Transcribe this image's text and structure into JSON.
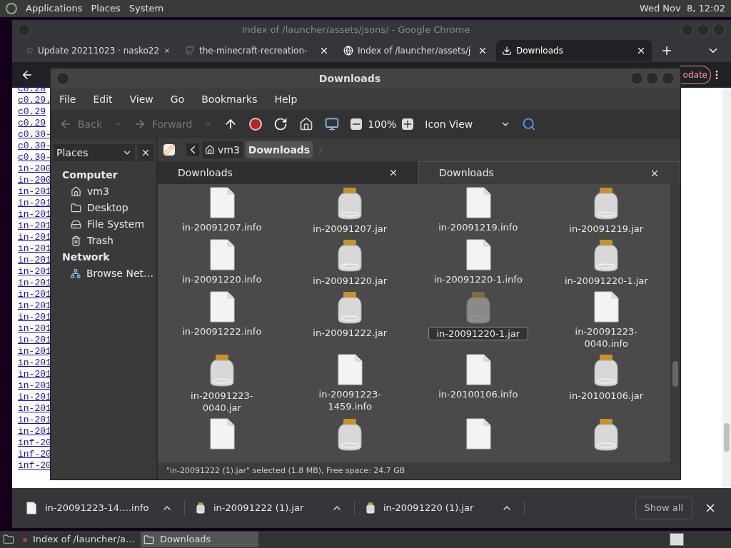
{
  "top_panel": {
    "menus": [
      "Applications",
      "Places",
      "System"
    ],
    "clock": "Wed Nov  8, 12:02"
  },
  "chrome": {
    "title": "Index of /launcher/assets/jsons/ - Google Chrome",
    "tabs": [
      {
        "label": "Update 20211023 · nasko22",
        "kind": "github",
        "selected": false
      },
      {
        "label": "the-minecraft-recreation-",
        "kind": "github",
        "selected": false
      },
      {
        "label": "Index of /launcher/assets/j",
        "kind": "globe",
        "selected": false
      },
      {
        "label": "Downloads",
        "kind": "download",
        "selected": true
      }
    ],
    "update_button": "odate",
    "page_links": [
      "c0.28",
      "c0.29.",
      "c0.29",
      "c0.29",
      "c0.30-",
      "c0.30-",
      "c0.30-",
      "in-200",
      "in-200",
      "in-201",
      "in-201",
      "in-201",
      "in-201",
      "in-201",
      "in-201",
      "in-201",
      "in-201",
      "in-201",
      "in-201",
      "in-201",
      "in-201",
      "in-201",
      "in-201",
      "in-201",
      "in-201",
      "in-201",
      "in-201",
      "in-201",
      "in-201",
      "in-201",
      "in-201",
      "inf-20",
      "inf-20",
      "inf-20"
    ],
    "downloads": [
      {
        "name": "in-20091223-14….info",
        "kind": "info"
      },
      {
        "name": "in-20091222 (1).jar",
        "kind": "jar"
      },
      {
        "name": "in-20091220 (1).jar",
        "kind": "jar"
      }
    ],
    "show_all": "Show all"
  },
  "file_manager": {
    "title": "Downloads",
    "menus": [
      "File",
      "Edit",
      "View",
      "Go",
      "Bookmarks",
      "Help"
    ],
    "toolbar": {
      "back": "Back",
      "forward": "Forward",
      "zoom": "100%",
      "view": "Icon View"
    },
    "sidebar": {
      "selector": "Places",
      "sections": [
        {
          "heading": "Computer",
          "items": [
            {
              "label": "vm3",
              "kind": "home"
            },
            {
              "label": "Desktop",
              "kind": "desktop"
            },
            {
              "label": "File System",
              "kind": "drive"
            },
            {
              "label": "Trash",
              "kind": "trash"
            }
          ]
        },
        {
          "heading": "Network",
          "items": [
            {
              "label": "Browse Net…",
              "kind": "network"
            }
          ]
        }
      ]
    },
    "path": [
      {
        "label": "vm3",
        "selected": false
      },
      {
        "label": "Downloads",
        "selected": true
      }
    ],
    "tabs": [
      {
        "label": "Downloads",
        "selected": false
      },
      {
        "label": "Downloads",
        "selected": true
      }
    ],
    "files": [
      {
        "name": "in-20091207.info",
        "kind": "info",
        "selected": false
      },
      {
        "name": "in-20091207.jar",
        "kind": "jar",
        "selected": false
      },
      {
        "name": "in-20091219.info",
        "kind": "info",
        "selected": false
      },
      {
        "name": "in-20091219.jar",
        "kind": "jar",
        "selected": false
      },
      {
        "name": "in-20091220.info",
        "kind": "info",
        "selected": false
      },
      {
        "name": "in-20091220.jar",
        "kind": "jar",
        "selected": false
      },
      {
        "name": "in-20091220-1.info",
        "kind": "info",
        "selected": false
      },
      {
        "name": "in-20091220-1.jar",
        "kind": "jar",
        "selected": false
      },
      {
        "name": "in-20091222.info",
        "kind": "info",
        "selected": false
      },
      {
        "name": "in-20091222.jar",
        "kind": "jar",
        "selected": false
      },
      {
        "name": "in-20091220-1.jar",
        "kind": "jar",
        "selected": true
      },
      {
        "name": "in-20091223-0040.info",
        "kind": "info",
        "selected": false
      },
      {
        "name": "in-20091223-0040.jar",
        "kind": "jar",
        "selected": false
      },
      {
        "name": "in-20091223-1459.info",
        "kind": "info",
        "selected": false
      },
      {
        "name": "in-20100106.info",
        "kind": "info",
        "selected": false
      },
      {
        "name": "in-20100106.jar",
        "kind": "jar",
        "selected": false
      },
      {
        "kind": "info",
        "selected": false
      },
      {
        "kind": "jar",
        "selected": false
      },
      {
        "kind": "info",
        "selected": false
      },
      {
        "kind": "jar",
        "selected": false
      }
    ],
    "status": "\"in-20091222 (1).jar\" selected (1.8 MB), Free space: 24.7 GB"
  },
  "taskbar": [
    {
      "label": "Index of /launcher/a…",
      "kind": "chrome",
      "selected": false
    },
    {
      "label": "Downloads",
      "kind": "folder",
      "selected": true
    }
  ]
}
